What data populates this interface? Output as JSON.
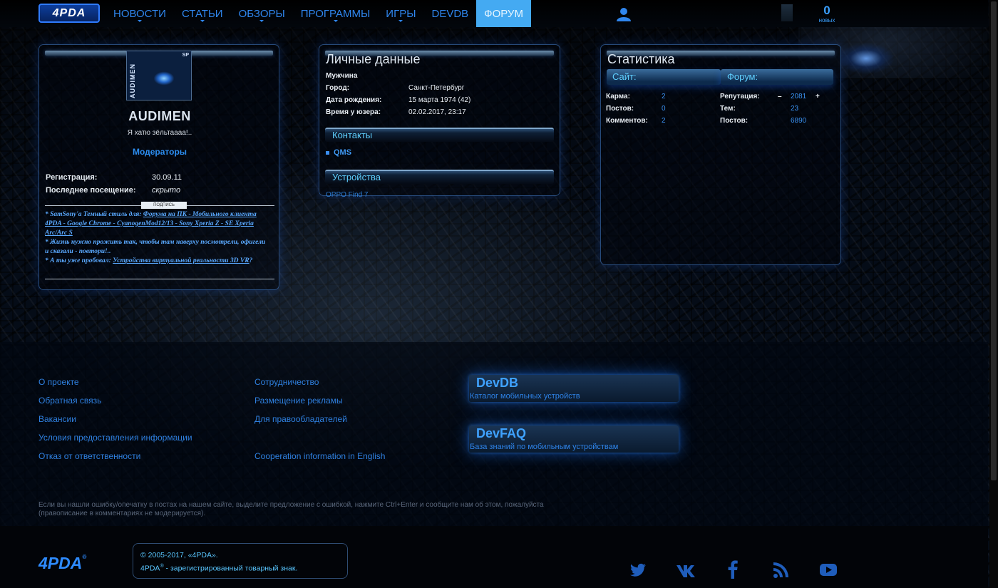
{
  "header": {
    "logo": "4PDA",
    "nav": [
      "НОВОСТИ",
      "СТАТЬИ",
      "ОБЗОРЫ",
      "ПРОГРАММЫ",
      "ИГРЫ",
      "DEVDB",
      "ФОРУМ"
    ],
    "active_nav": "ФОРУМ",
    "notifications_count": "0",
    "notifications_label": "новых",
    "accent_color": "#44aaf2"
  },
  "profile": {
    "avatar_text": "AUDIMEN",
    "avatar_corner": "SP",
    "username": "AUDIMEN",
    "status": "Я хатю зёльтаааа!..",
    "group": "Модераторы",
    "registration_label": "Регистрация:",
    "registration_value": "30.09.11",
    "last_visit_label": "Последнее посещение:",
    "last_visit_value": "скрыто",
    "signature_label": "ПОДПИСЬ",
    "signature": {
      "l1a": "* SamSony'a Темный стиль для: ",
      "l1b": "Форума на ПК - Мобильного клиента 4PDA - Google Chrome - CyanogenMod12/13 - Sony Xperia Z - SE Xperia Arc/Arc S",
      "l2": "* Жизнь нужно прожить так, чтобы там наверху посмотрели, офигели и сказали - повтори!..",
      "l3a": "* А ты уже пробовал: ",
      "l3b": "Устройства виртуальной реальности 3D VR",
      "l3c": "?"
    }
  },
  "personal": {
    "title": "Личные данные",
    "gender": "Мужчина",
    "city_label": "Город:",
    "city_value": "Санкт-Петербург",
    "birth_label": "Дата рождения:",
    "birth_value": "15 марта 1974 (42)",
    "time_label": "Время у юзера:",
    "time_value": "02.02.2017, 23:17",
    "contacts_title": "Контакты",
    "qms": "QMS",
    "devices_title": "Устройства",
    "device": "OPPO Find 7"
  },
  "stats": {
    "title": "Статистика",
    "site_title": "Сайт:",
    "forum_title": "Форум:",
    "site": [
      {
        "label": "Карма:",
        "value": "2"
      },
      {
        "label": "Постов:",
        "value": "0"
      },
      {
        "label": "Комментов:",
        "value": "2"
      }
    ],
    "forum": {
      "rep_label": "Репутация:",
      "rep_minus": "–",
      "rep_value": "2081",
      "rep_plus": "+",
      "topics_label": "Тем:",
      "topics_value": "23",
      "posts_label": "Постов:",
      "posts_value": "6890"
    }
  },
  "footer": {
    "col1": [
      "О проекте",
      "Обратная связь",
      "Вакансии",
      "Условия предоставления информации",
      "Отказ от ответственности"
    ],
    "col2": [
      "Сотрудничество",
      "Размещение рекламы",
      "Для правообладателей",
      "Cooperation information in English"
    ],
    "devdb_title": "DevDB",
    "devdb_sub": "Каталог мобильных устройств",
    "devfaq_title": "DevFAQ",
    "devfaq_sub": "База знаний по мобильным устройствам",
    "note": "Если вы нашли ошибку/опечатку в постах на нашем сайте, выделите предложение с ошибкой, нажмите Ctrl+Enter и сообщите нам об этом, пожалуйста (правописание в комментариях не модерируется).",
    "logo": "4PDA",
    "reg_mark": "®",
    "copyright": "© 2005-2017, «4PDA».",
    "trademark_name": "4PDA",
    "trademark_rest": " - зарегистрированный товарный знак.",
    "social": [
      "twitter-icon",
      "vk-icon",
      "facebook-icon",
      "rss-icon",
      "youtube-icon"
    ]
  }
}
